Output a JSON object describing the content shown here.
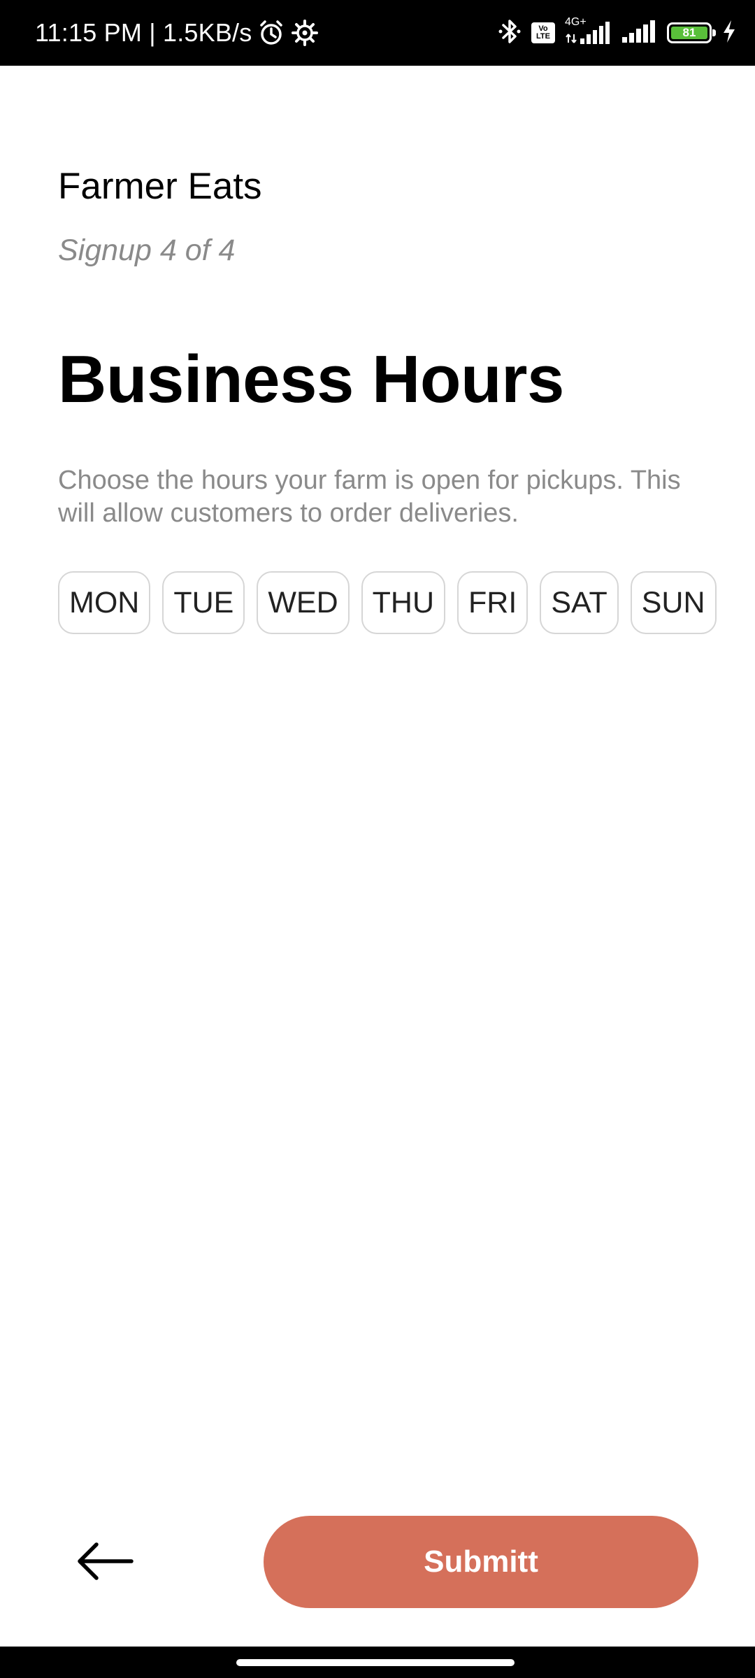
{
  "status_bar": {
    "time_speed": "11:15 PM | 1.5KB/s",
    "volte_label": "Vo LTE",
    "network_label": "4G+",
    "battery_level": "81"
  },
  "app": {
    "title": "Farmer Eats",
    "step": "Signup 4 of 4"
  },
  "page": {
    "heading": "Business Hours",
    "description": "Choose the hours your farm is open for pickups. This will allow customers to order deliveries."
  },
  "days": [
    "MON",
    "TUE",
    "WED",
    "THU",
    "FRI",
    "SAT",
    "SUN"
  ],
  "actions": {
    "submit_label": "Submitt"
  },
  "icons": {
    "back": "arrow-left-icon",
    "alarm": "alarm-icon",
    "settings": "gear-icon",
    "bluetooth": "bluetooth-icon",
    "charging": "lightning-icon"
  },
  "colors": {
    "accent": "#d5705a",
    "battery": "#59c03a",
    "muted_text": "#8a8a8a"
  }
}
